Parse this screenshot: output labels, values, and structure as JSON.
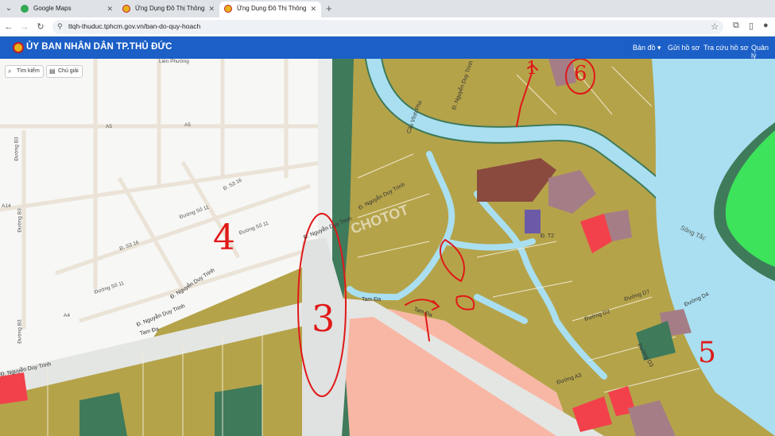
{
  "browser": {
    "tabs": [
      {
        "title": "Google Maps",
        "active": false
      },
      {
        "title": "Ứng Dụng Đô Thị Thông Minh",
        "active": false
      },
      {
        "title": "Ứng Dụng Đô Thị Thông Minh",
        "active": true
      }
    ],
    "url": "ttqh-thuduc.tphcm.gov.vn/ban-do-quy-hoach"
  },
  "app": {
    "title": "ỦY BAN NHÂN DÂN TP.THỦ ĐỨC",
    "menu": [
      "Bản đồ",
      "Gửi hồ sơ",
      "Tra cứu hồ sơ",
      "Quản lý"
    ]
  },
  "map": {
    "buttons": {
      "search": "Tìm kiếm",
      "legend": "Chú giải"
    },
    "labels": {
      "lien_phuong": "Liên Phường",
      "a5_1": "A5",
      "a5_2": "A5",
      "a14": "A14",
      "a4": "A4",
      "duong_b3_1": "Đường B3",
      "duong_b3_2": "Đường B3",
      "duong_b3_3": "Đường B3",
      "d_s3_16_1": "Đ. S3 16",
      "d_s3_16_2": "Đ. S3 16",
      "duong_so_11_1": "Đường Số 11",
      "duong_so_11_2": "Đường Số 11",
      "duong_so_11_3": "Đường Số 11",
      "nguyen_duy_trinh_1": "Đ. Nguyễn Duy Trinh",
      "nguyen_duy_trinh_2": "Đ. Nguyễn Duy Trinh",
      "nguyen_duy_trinh_3": "Đ. Nguyễn Duy Trinh",
      "nguyen_duy_trinh_4": "Đ. Nguyễn Duy Trinh",
      "nguyen_duy_trinh_5": "Đ. Nguyễn Duy Trinh",
      "nguyen_duy_trinh_6": "Đ. Nguyễn Duy Trinh",
      "tam_da_1": "Tam Đa",
      "tam_da_2": "Tam Đa",
      "tam_da_3": "Tam Đa",
      "d_t2": "Đ. T2",
      "d_d2": "Đường D2",
      "d_d3": "Đường D3",
      "d_d7": "Đường D7",
      "d_d4": "Đường D4",
      "d_a3": "Đường A3",
      "song_tac": "Sông Tắc",
      "cau_vinh_phu": "Cầu Vĩnh Phú",
      "watermark": "CHOTOT"
    },
    "annotations": {
      "n1": "1",
      "n3": "3",
      "n4": "4",
      "n5": "5",
      "n6": "6"
    },
    "colors": {
      "residential": "#b5a34a",
      "water": "#a9dff0",
      "greenbelt": "#3f7a5b",
      "commercial": "#8a4a3e",
      "pink_zone": "#f8b7a4",
      "red_lot": "#f2414a",
      "mauve_lot": "#a57d86",
      "park": "#3de35a",
      "annotation_ink": "#e01818"
    }
  }
}
